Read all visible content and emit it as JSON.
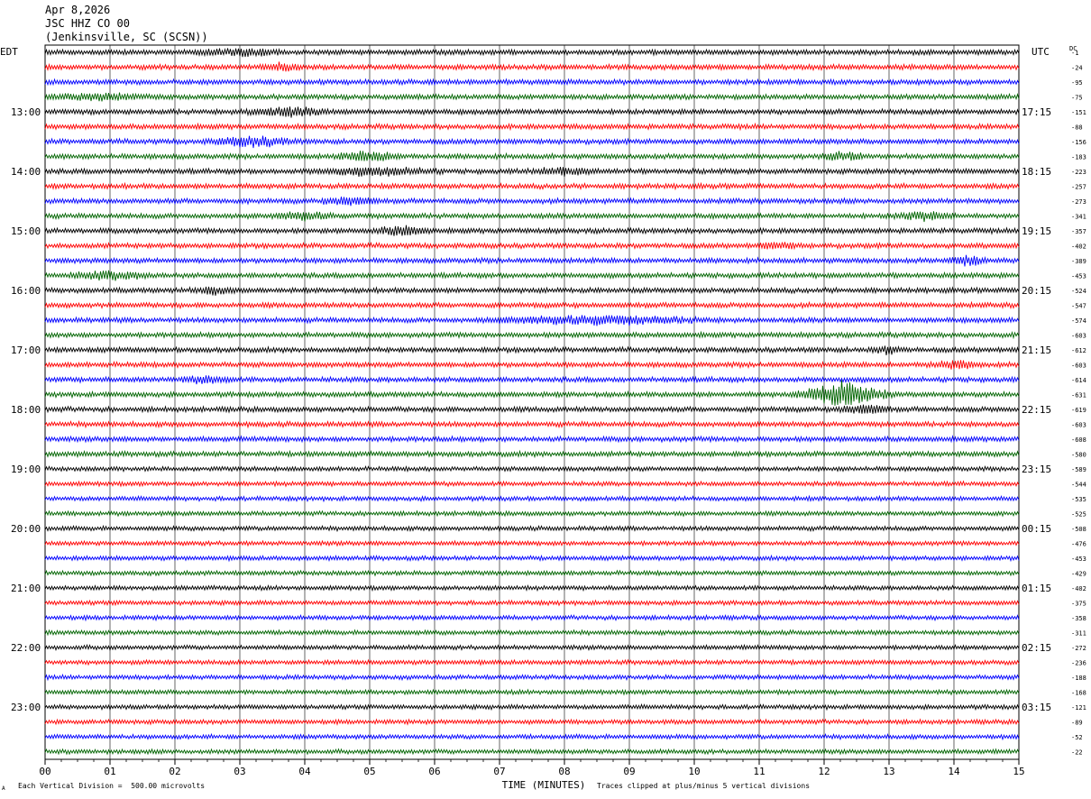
{
  "header": {
    "date": "Apr 8,2026",
    "station": "JSC HHZ CO 00",
    "location": "(Jenkinsville, SC (SCSN))"
  },
  "left_timezone": "EDT",
  "right_timezone": "UTC",
  "dc_label": "DC",
  "footer": {
    "scale_text": "Each Vertical Division =  500.00 microvolts",
    "clip_text": "Traces clipped at plus/minus 5 vertical divisions",
    "corner_mark": "A"
  },
  "colors": {
    "trace_cycle": [
      "#000000",
      "#ff0000",
      "#0000ff",
      "#006400"
    ],
    "grid": "#000000"
  },
  "chart_data": {
    "type": "line",
    "subtype": "helicorder",
    "xlabel": "TIME (MINUTES)",
    "x_ticks": [
      "00",
      "01",
      "02",
      "03",
      "04",
      "05",
      "06",
      "07",
      "08",
      "09",
      "10",
      "11",
      "12",
      "13",
      "14",
      "15"
    ],
    "xlim": [
      0,
      15
    ],
    "left_hour_labels": [
      "13:00",
      "14:00",
      "15:00",
      "16:00",
      "17:00",
      "18:00",
      "19:00",
      "20:00",
      "21:00",
      "22:00",
      "23:00"
    ],
    "right_hour_labels": [
      "17:15",
      "18:15",
      "19:15",
      "20:15",
      "21:15",
      "22:15",
      "23:15",
      "00:15",
      "01:15",
      "02:15",
      "03:15"
    ],
    "dc_offsets": [
      "-1",
      "-24",
      "-95",
      "-75",
      "-151",
      "-88",
      "-156",
      "-183",
      "-223",
      "-257",
      "-273",
      "-341",
      "-357",
      "-402",
      "-389",
      "-453",
      "-524",
      "-547",
      "-574",
      "-603",
      "-612",
      "-603",
      "-614",
      "-631",
      "-619",
      "-603",
      "-608",
      "-580",
      "-589",
      "-544",
      "-535",
      "-525",
      "-508",
      "-476",
      "-453",
      "-429",
      "-402",
      "-375",
      "-358",
      "-311",
      "-272",
      "-236",
      "-188",
      "-168",
      "-121",
      "-89",
      "-52",
      "-22"
    ],
    "trace_count": 48,
    "minutes_per_trace": 15
  }
}
